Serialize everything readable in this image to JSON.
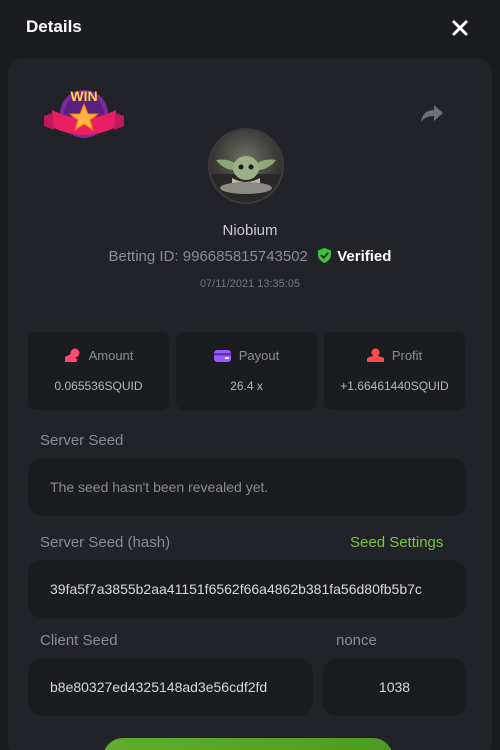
{
  "header": {
    "title": "Details"
  },
  "user": {
    "name": "Niobium",
    "betting_label": "Betting ID:",
    "betting_id": "996685815743502",
    "verified_text": "Verified",
    "date": "07/11/2021 13:35:05"
  },
  "badge": {
    "text": "WIN"
  },
  "stats": [
    {
      "label": "Amount",
      "value": "0.065536SQUID",
      "icon": "coins-icon"
    },
    {
      "label": "Payout",
      "value": "26.4 x",
      "icon": "wallet-icon"
    },
    {
      "label": "Profit",
      "value": "+1.66461440SQUID",
      "icon": "profit-icon"
    }
  ],
  "server_seed": {
    "label": "Server Seed",
    "value": "The seed hasn't been revealed yet."
  },
  "server_seed_hash": {
    "label": "Server Seed (hash)",
    "link": "Seed Settings",
    "value": "39fa5f7a3855b2aa41151f6562f66a4862b381fa56d80fb5b7c"
  },
  "client_seed": {
    "label": "Client Seed",
    "value": "b8e80327ed4325148ad3e56cdf2fd"
  },
  "nonce": {
    "label": "nonce",
    "value": "1038"
  },
  "colors": {
    "accent": "#7cc43a",
    "verified": "#3ec23e",
    "bg": "#1b1c20",
    "panel": "#222328"
  }
}
